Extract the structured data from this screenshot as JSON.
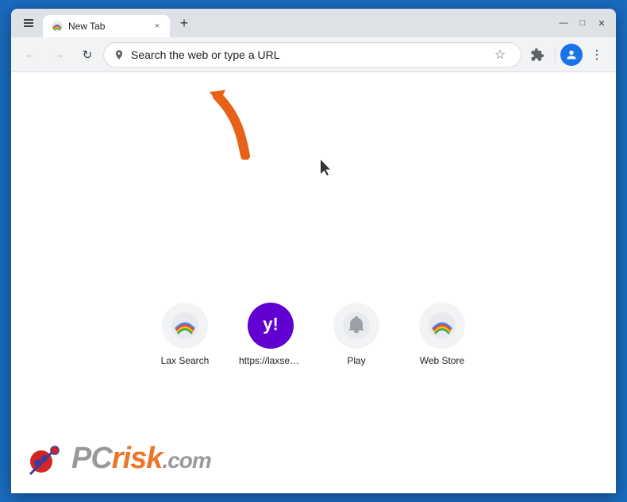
{
  "browser": {
    "tab": {
      "favicon_label": "New Tab favicon",
      "title": "New Tab",
      "close_label": "×"
    },
    "new_tab_label": "+",
    "window_controls": {
      "minimize": "—",
      "maximize": "□",
      "close": "✕"
    }
  },
  "navbar": {
    "back_label": "←",
    "forward_label": "→",
    "refresh_label": "↻",
    "address_placeholder": "Search the web or type a URL",
    "address_value": "Search the web or type a URL",
    "bookmark_label": "☆",
    "extensions_label": "🧩",
    "profile_label": "👤",
    "menu_label": "⋮"
  },
  "shortcuts": [
    {
      "id": "lax-search",
      "label": "Lax Search",
      "type": "rainbow"
    },
    {
      "id": "laxsea-url",
      "label": "https://laxsea...",
      "type": "yahoo"
    },
    {
      "id": "play",
      "label": "Play",
      "type": "bell"
    },
    {
      "id": "web-store",
      "label": "Web Store",
      "type": "rainbow2"
    }
  ],
  "watermark": {
    "text_pc": "PC",
    "text_risk": "risk",
    "text_com": ".com"
  },
  "colors": {
    "border": "#1a6bbf",
    "accent": "#1a73e8",
    "arrow": "#e8611a"
  }
}
